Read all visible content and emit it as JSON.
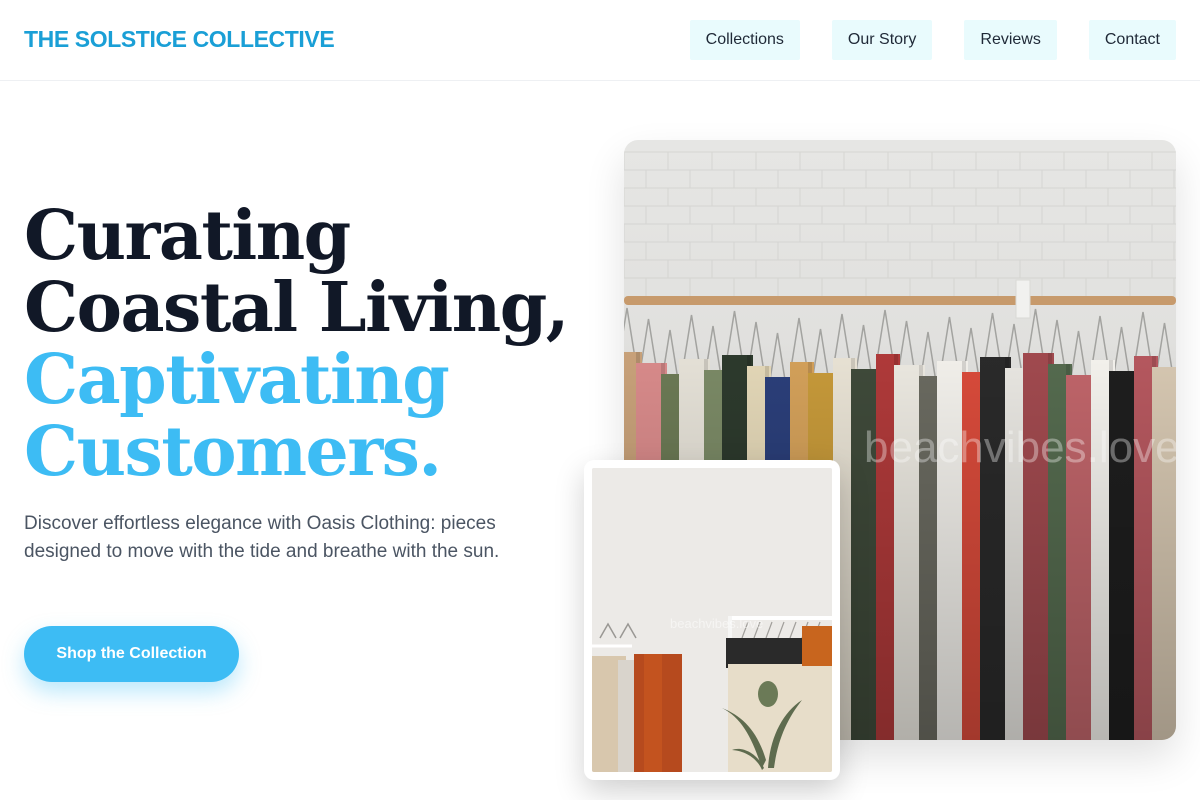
{
  "header": {
    "brand": "THE SOLSTICE COLLECTIVE",
    "nav": [
      "Collections",
      "Our Story",
      "Reviews",
      "Contact"
    ]
  },
  "hero": {
    "title_line_1": "Curating",
    "title_line_2": "Coastal Living,",
    "title_line_3": "Captivating",
    "title_line_4": "Customers.",
    "subtitle": "Discover effortless elegance with Oasis Clothing: pieces designed to move with the tide and breathe with the sun.",
    "cta_label": "Shop the Collection"
  },
  "images": {
    "main_watermark": "beachvibes.love",
    "inset_watermark": "beachvibes.love"
  },
  "colors": {
    "brand": "#1a9fd6",
    "accent": "#3dbcf4",
    "nav_bg": "#e9fbfd"
  }
}
